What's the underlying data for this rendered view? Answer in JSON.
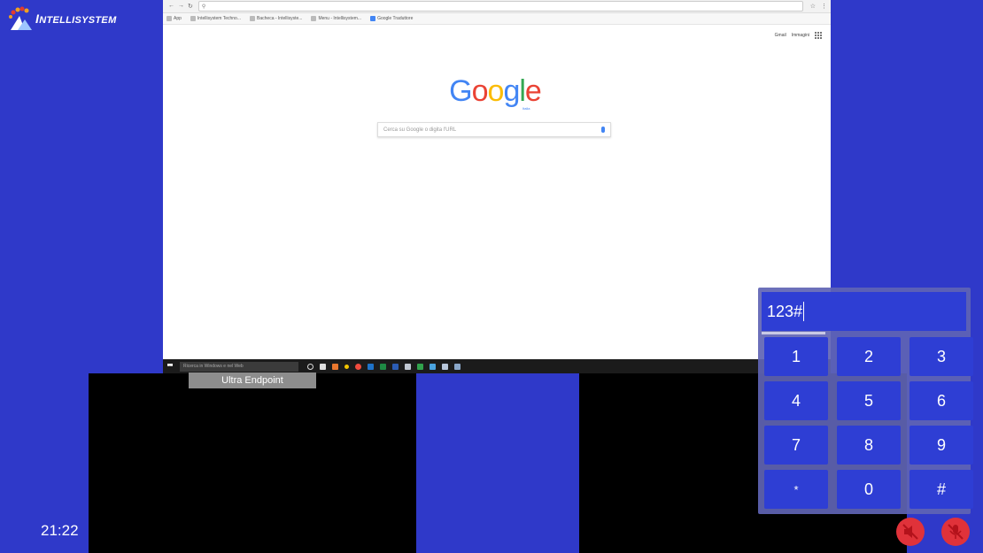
{
  "brand": {
    "name_prefix": "I",
    "name_rest": "NTELLISYSTEM"
  },
  "clock": "21:22",
  "endpoint_label": "Ultra Endpoint",
  "shared_screen": {
    "bookmarks": [
      {
        "label": "App"
      },
      {
        "label": "Intellisystem Techno..."
      },
      {
        "label": "Bacheca - Intellisyste..."
      },
      {
        "label": "Menu - Intellisystem..."
      },
      {
        "label": "Google Traduttore"
      }
    ],
    "google_links": {
      "gmail": "Gmail",
      "images": "Immagini"
    },
    "google_region": "Italia",
    "search_placeholder": "Cerca su Google o digita l'URL",
    "taskbar_search": "Ricerca in Windows e nel Web"
  },
  "keypad": {
    "value": "123#",
    "keys": [
      "1",
      "2",
      "3",
      "4",
      "5",
      "6",
      "7",
      "8",
      "9",
      "*",
      "0",
      "#"
    ]
  },
  "colors": {
    "background": "#2f39c9",
    "key": "#2e3ed4",
    "mute": "#e0323a"
  },
  "icons": {
    "speaker": "speaker-muted-icon",
    "microphone": "microphone-muted-icon"
  }
}
